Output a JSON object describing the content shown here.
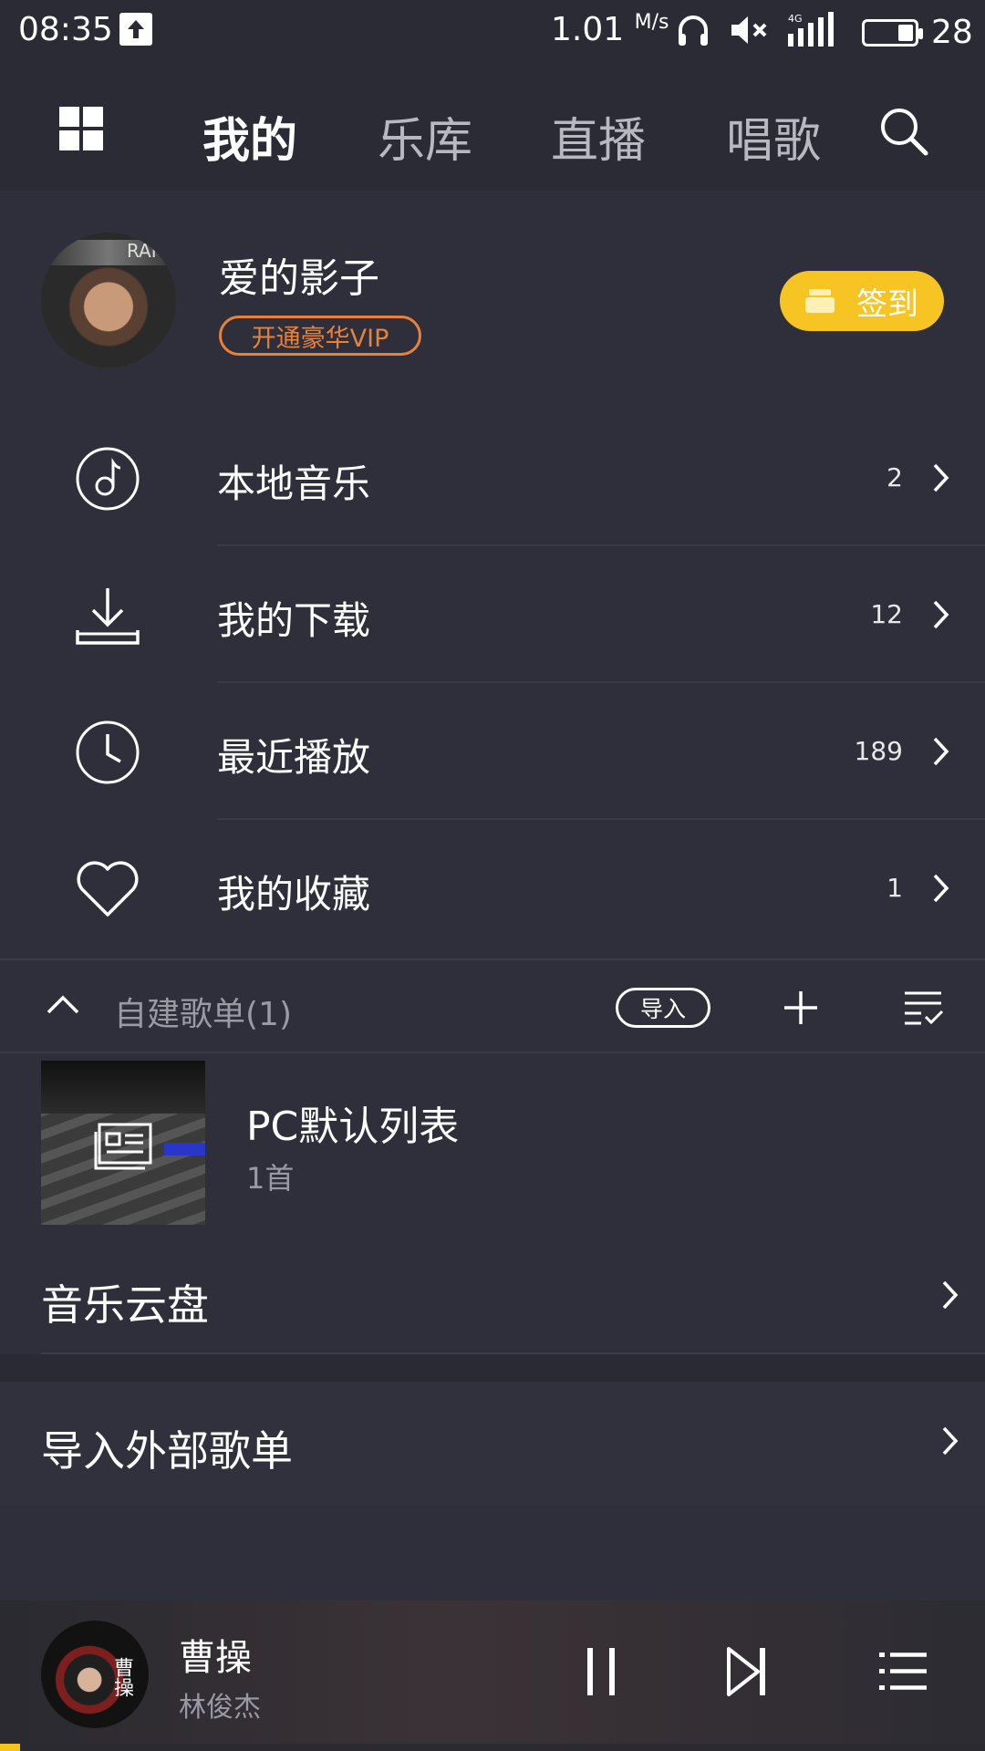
{
  "status_bar": {
    "time": "08:35",
    "speed": "1.01",
    "speed_unit": "M/s",
    "network": "4G",
    "battery": "28"
  },
  "nav": {
    "tabs": [
      {
        "label": "我的",
        "active": true
      },
      {
        "label": "乐库",
        "active": false
      },
      {
        "label": "直播",
        "active": false
      },
      {
        "label": "唱歌",
        "active": false
      }
    ]
  },
  "profile": {
    "username": "爱的影子",
    "vip_label": "开通豪华VIP",
    "checkin_label": "签到",
    "accent": "#f6c524",
    "vip_color": "#e98239"
  },
  "menu": [
    {
      "icon": "music-note-icon",
      "label": "本地音乐",
      "count": "2"
    },
    {
      "icon": "download-icon",
      "label": "我的下载",
      "count": "12"
    },
    {
      "icon": "clock-icon",
      "label": "最近播放",
      "count": "189"
    },
    {
      "icon": "heart-icon",
      "label": "我的收藏",
      "count": "1"
    }
  ],
  "playlists": {
    "header_label": "自建歌单(1)",
    "import_label": "导入",
    "items": [
      {
        "title": "PC默认列表",
        "count": "1首"
      }
    ]
  },
  "cloud_label": "音乐云盘",
  "import_external_label": "导入外部歌单",
  "player": {
    "song": "曹操",
    "artist": "林俊杰",
    "progress": 0.02
  }
}
